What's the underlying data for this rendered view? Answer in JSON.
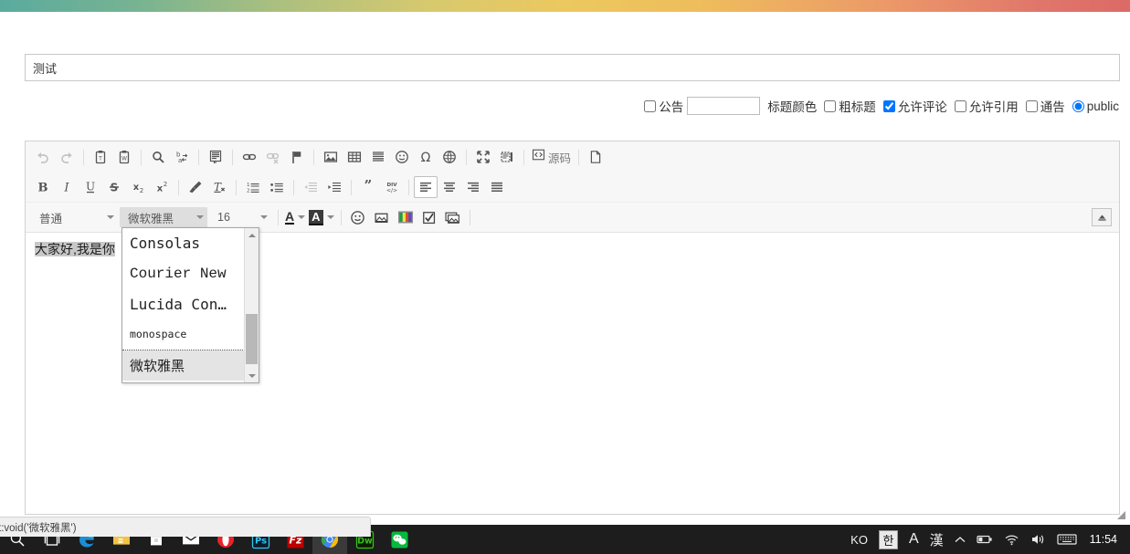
{
  "window": {
    "gradient_colors": [
      "#5aab9e",
      "#ecc85f",
      "#dc6a66"
    ]
  },
  "post": {
    "title_value": "测试",
    "title_placeholder": "",
    "options": [
      {
        "name": "announce",
        "type": "checkbox",
        "label": "公告",
        "checked": false
      },
      {
        "name": "title-color",
        "type": "text",
        "label": "标题颜色",
        "value": ""
      },
      {
        "name": "bold-title",
        "type": "checkbox",
        "label": "粗标题",
        "checked": false
      },
      {
        "name": "allow-comment",
        "type": "checkbox",
        "label": "允许评论",
        "checked": true
      },
      {
        "name": "allow-quote",
        "type": "checkbox",
        "label": "允许引用",
        "checked": false
      },
      {
        "name": "notice",
        "type": "checkbox",
        "label": "通告",
        "checked": false
      },
      {
        "name": "public",
        "type": "radio",
        "label": "public",
        "checked": true
      }
    ],
    "color_label": "标题颜色"
  },
  "editor": {
    "toolbar_row1": [
      {
        "icon": "undo-icon",
        "label": "撤销",
        "disabled": true
      },
      {
        "icon": "redo-icon",
        "label": "重做",
        "disabled": true
      },
      {
        "sep": true
      },
      {
        "icon": "paste-as-plain-text-icon",
        "label": "粘贴为无格式文本"
      },
      {
        "icon": "paste-from-word-icon",
        "label": "从 Word 粘贴"
      },
      {
        "sep": true
      },
      {
        "icon": "search-icon",
        "label": "查找"
      },
      {
        "icon": "replace-icon",
        "label": "替换"
      },
      {
        "sep": true
      },
      {
        "icon": "select-all-icon",
        "label": "全选"
      },
      {
        "sep": true
      },
      {
        "icon": "link-icon",
        "label": "插入链接"
      },
      {
        "icon": "unlink-icon",
        "label": "取消链接",
        "disabled": true
      },
      {
        "icon": "anchor-flag-icon",
        "label": "锚点"
      },
      {
        "sep": true
      },
      {
        "icon": "image-icon",
        "label": "图像"
      },
      {
        "icon": "table-icon",
        "label": "表格"
      },
      {
        "icon": "horizontal-rule-icon",
        "label": "水平线"
      },
      {
        "icon": "smiley-icon",
        "label": "表情"
      },
      {
        "icon": "special-char-icon",
        "label": "特殊字符"
      },
      {
        "icon": "globe-iframe-icon",
        "label": "IFrame"
      },
      {
        "sep": true
      },
      {
        "icon": "maximize-icon",
        "label": "全屏"
      },
      {
        "icon": "show-blocks-icon",
        "label": "显示区块"
      },
      {
        "sep": true
      },
      {
        "icon": "source-icon",
        "label": "源码"
      },
      {
        "sep": true
      },
      {
        "icon": "page-break-icon",
        "label": "分页符"
      }
    ],
    "source_label": "源码",
    "toolbar_row2": [
      {
        "icon": "bold-icon",
        "label": "加粗"
      },
      {
        "icon": "italic-icon",
        "label": "倾斜"
      },
      {
        "icon": "underline-icon",
        "label": "下划线"
      },
      {
        "icon": "strikethrough-icon",
        "label": "删除线"
      },
      {
        "icon": "subscript-icon",
        "label": "下标"
      },
      {
        "icon": "superscript-icon",
        "label": "上标"
      },
      {
        "sep": true
      },
      {
        "icon": "copy-formatting-icon",
        "label": "格式刷"
      },
      {
        "icon": "remove-format-icon",
        "label": "清除格式"
      },
      {
        "sep": true
      },
      {
        "icon": "numbered-list-icon",
        "label": "编号列表"
      },
      {
        "icon": "bulleted-list-icon",
        "label": "项目列表"
      },
      {
        "sep": true
      },
      {
        "icon": "outdent-icon",
        "label": "减少缩进",
        "disabled": true
      },
      {
        "icon": "indent-icon",
        "label": "增加缩进"
      },
      {
        "sep": true
      },
      {
        "icon": "blockquote-icon",
        "label": "块引用"
      },
      {
        "icon": "div-container-icon",
        "label": "创建 Div 容器"
      },
      {
        "sep": true
      },
      {
        "icon": "align-left-icon",
        "label": "左对齐",
        "active": true
      },
      {
        "icon": "align-center-icon",
        "label": "居中"
      },
      {
        "icon": "align-right-icon",
        "label": "右对齐"
      },
      {
        "icon": "align-justify-icon",
        "label": "两端对齐"
      }
    ],
    "combos": [
      {
        "name": "format-combo",
        "value": "普通"
      },
      {
        "name": "font-combo",
        "value": "微软雅黑",
        "open": true
      },
      {
        "name": "size-combo",
        "value": "16"
      }
    ],
    "toolbar_row3_tools": [
      {
        "icon": "text-color-icon",
        "label": "文本颜色"
      },
      {
        "icon": "background-color-icon",
        "label": "背景颜色"
      },
      {
        "sep": true
      },
      {
        "icon": "smiley-icon",
        "label": "表情"
      },
      {
        "icon": "image-placeholder-icon",
        "label": "图片"
      },
      {
        "icon": "color-palette-icon",
        "label": "调色板"
      },
      {
        "icon": "checkbox-icon",
        "label": "复选框"
      },
      {
        "icon": "image-alt-icon",
        "label": "图像"
      },
      {
        "sep": true
      }
    ],
    "collapse_toolbar_label": "折叠工具栏",
    "content_text": "大家好,我是你"
  },
  "font_menu": {
    "items": [
      {
        "label": "Consolas",
        "selected": false
      },
      {
        "label": "Courier New",
        "selected": false
      },
      {
        "label": "Lucida Con…",
        "selected": false
      },
      {
        "label": "monospace",
        "selected": false,
        "focused": true
      },
      {
        "label": "微软雅黑",
        "selected": true
      }
    ]
  },
  "status_bar": {
    "text": "t:void('微软雅黑')"
  },
  "taskbar": {
    "items": [
      {
        "name": "search-icon",
        "label": "搜索"
      },
      {
        "name": "task-view-icon",
        "label": "任务视图"
      },
      {
        "name": "edge-icon",
        "label": "Microsoft Edge"
      },
      {
        "name": "file-explorer-icon",
        "label": "文件资源管理器"
      },
      {
        "name": "store-icon",
        "label": "应用商店"
      },
      {
        "name": "mail-icon",
        "label": "邮件"
      },
      {
        "name": "opera-icon",
        "label": "Opera"
      },
      {
        "name": "photoshop-icon",
        "label": "Ps"
      },
      {
        "name": "filezilla-icon",
        "label": "Fz"
      },
      {
        "name": "chrome-icon",
        "label": "Google Chrome",
        "running": true
      },
      {
        "name": "dreamweaver-icon",
        "label": "Dw"
      },
      {
        "name": "wechat-icon",
        "label": "微信"
      }
    ],
    "tray": {
      "lang": "KO",
      "ime": "한",
      "mode_a": "A",
      "mode_han": "漢",
      "icons": [
        "chevron-up-icon",
        "battery-icon",
        "wifi-icon",
        "volume-icon",
        "keyboard-icon"
      ],
      "clock": "11:54"
    }
  }
}
